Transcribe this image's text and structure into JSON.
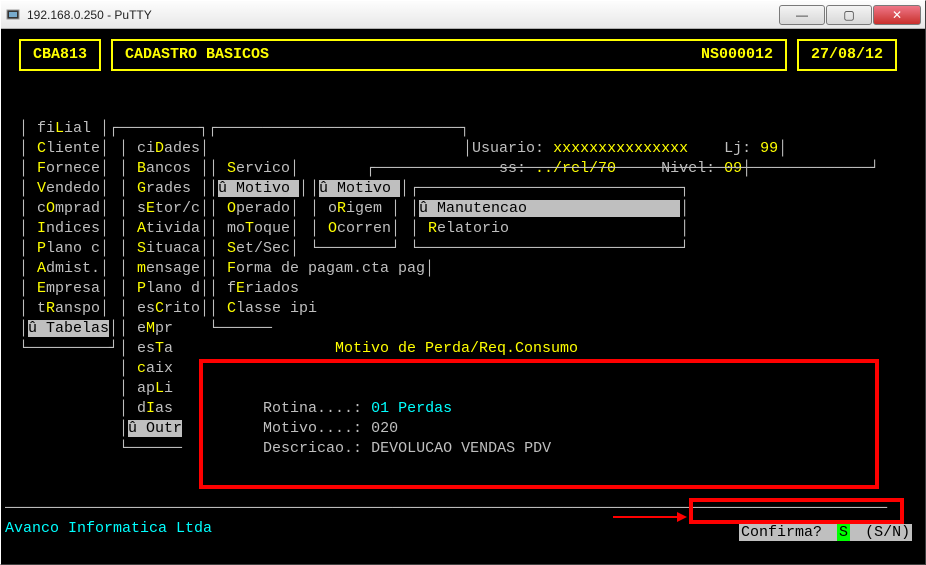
{
  "window": {
    "title": "192.168.0.250 - PuTTY"
  },
  "header": {
    "code": "CBA813",
    "title": "CADASTRO BASICOS",
    "ns": "NS000012",
    "date": "27/08/12"
  },
  "userpanel": {
    "user_label": "Usuario:",
    "user_value": "xxxxxxxxxxxxxxx",
    "lj_label": "Lj:",
    "lj_value": "99",
    "ss_label": "ss:",
    "ss_value": "../rel/70",
    "nivel_label": "Nivel:",
    "nivel_value": "09"
  },
  "menu1": [
    "fiLial",
    "Cliente",
    "Fornece",
    "Vendedo",
    "cOmprad",
    "Indices",
    "Plano c",
    "Admist.",
    "Empresa",
    "tRanspo",
    "û Tabelas"
  ],
  "menu2": [
    "ciDades",
    "Bancos",
    "Grades",
    "sEtor/c",
    "Ativida",
    "Situaca",
    "mensage",
    "Plano d",
    "esCrito",
    "eMpr",
    "esTa",
    "caix",
    "apLi",
    "dIas",
    "û Outr"
  ],
  "menu3": [
    "Servico",
    "û Motivo",
    "Operado",
    "moToque",
    "Set/Sec",
    "Forma de pagam.cta pag",
    "fEriados",
    "Classe ipi"
  ],
  "menu4": [
    "û Motivo",
    "oRigem",
    "Ocorren"
  ],
  "menu5": [
    "û Manutencao",
    "Relatorio"
  ],
  "formbox": {
    "title": "Motivo de Perda/Req.Consumo",
    "rotina_label": "Rotina....:",
    "rotina_value": "01 Perdas",
    "motivo_label": "Motivo....:",
    "motivo_value": "020",
    "descr_label": "Descricao.:",
    "descr_value": "DEVOLUCAO VENDAS PDV"
  },
  "footer": {
    "company": "Avanco Informatica Ltda",
    "prompt": "Confirma?",
    "prompt_val": "S",
    "prompt_opts": "(S/N)"
  }
}
